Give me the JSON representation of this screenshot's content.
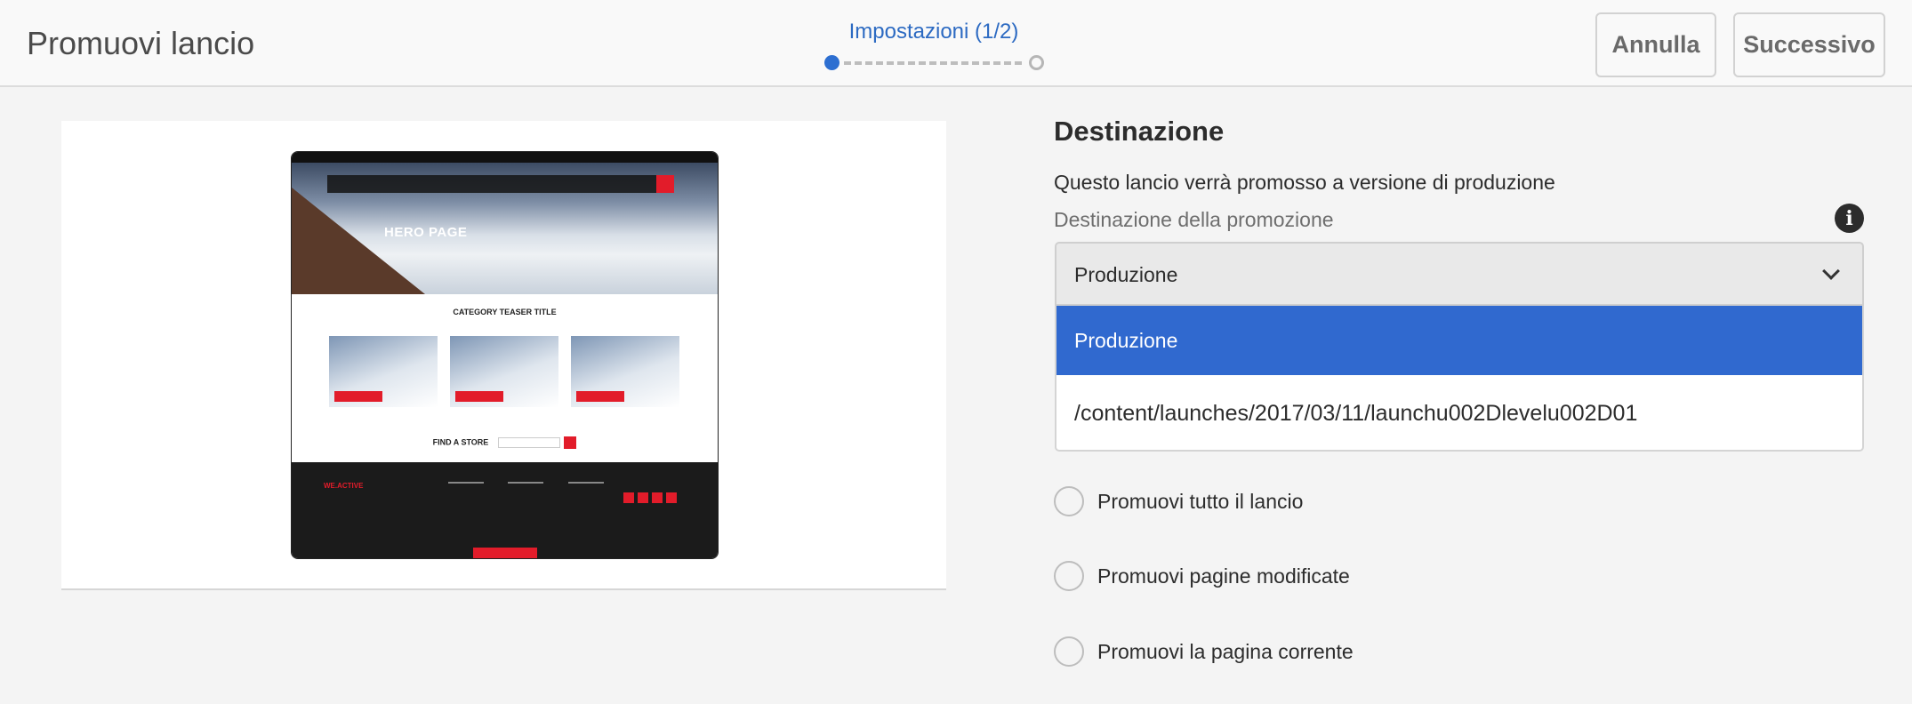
{
  "header": {
    "title": "Promuovi lancio",
    "step_label": "Impostazioni (1/2)",
    "cancel_label": "Annulla",
    "next_label": "Successivo"
  },
  "preview": {
    "hero_text": "HERO PAGE",
    "category_title": "CATEGORY TEASER TITLE",
    "store_label": "FIND A STORE",
    "footer_brand": "WE.ACTIVE"
  },
  "form": {
    "section_title": "Destinazione",
    "description": "Questo lancio verrà promosso a versione di produzione",
    "field_label": "Destinazione della promozione",
    "selected_value": "Produzione",
    "options": [
      "Produzione",
      "/content/launches/2017/03/11/launchu002Dlevelu002D01"
    ],
    "radios": [
      "Promuovi tutto il lancio",
      "Promuovi pagine modificate",
      "Promuovi la pagina corrente"
    ]
  },
  "colors": {
    "accent": "#2c6ac2",
    "selected_option": "#3069cf",
    "brand_red": "#e21c2a"
  },
  "icons": {
    "info": "info-icon",
    "dropdown": "chevron-down-icon"
  }
}
